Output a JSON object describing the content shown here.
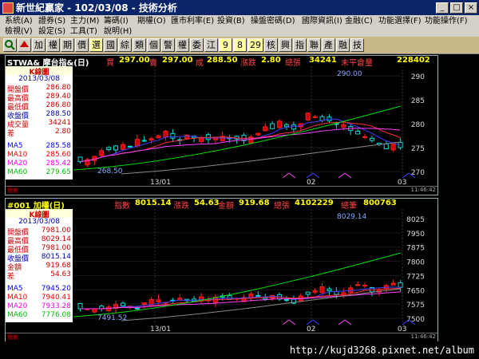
{
  "window": {
    "title": "新世紀贏家 - 102/03/08 - 技術分析"
  },
  "menu": [
    {
      "label": "系統(A)"
    },
    {
      "label": "證券(S)"
    },
    {
      "label": "主力(M)"
    },
    {
      "label": "籌碼(I)"
    },
    {
      "label": "期權(O)"
    },
    {
      "label": "匯市利率(E)"
    },
    {
      "label": "投資(B)"
    },
    {
      "label": "操盤密碼(D)"
    },
    {
      "label": "國際資訊(I)"
    },
    {
      "label": "金融(C)"
    },
    {
      "label": "功能選擇(F)"
    },
    {
      "label": "功能操作(F)"
    },
    {
      "label": "檢視(V)"
    },
    {
      "label": "設定(S)"
    },
    {
      "label": "工具(T)"
    },
    {
      "label": "說明(H)"
    }
  ],
  "toolbar": [
    "加",
    "權",
    "期",
    "價",
    "選",
    "國",
    "綜",
    "類",
    "個",
    "警",
    "權",
    "委",
    "江",
    "9",
    "8",
    "29",
    "核",
    "興",
    "指",
    "聯",
    "產",
    "融",
    "技"
  ],
  "panel1": {
    "symbol": "STWA& 摩台指&(日)",
    "buy_label": "買",
    "buy": "297.00",
    "sell_label": "賣",
    "sell": "297.00",
    "deal_label": "成",
    "deal": "288.50",
    "change_label": "漲跌",
    "change": "2.80",
    "vol_label": "總張",
    "vol": "34241",
    "oi_label": "未平倉量",
    "oi": "228402",
    "info_title": "K線圖",
    "info_date": "2013/03/08",
    "rows": [
      {
        "label": "開盤價",
        "value": "286.80",
        "color": "#c00"
      },
      {
        "label": "最高價",
        "value": "289.40",
        "color": "#c00"
      },
      {
        "label": "最低價",
        "value": "286.80",
        "color": "#c00"
      },
      {
        "label": "收盤價",
        "value": "288.50",
        "color": "#00a"
      },
      {
        "label": "成交量",
        "value": "34241",
        "color": "#c00"
      },
      {
        "label": "差",
        "value": "2.80",
        "color": "#c00"
      }
    ],
    "ma": [
      {
        "label": "MA5",
        "value": "285.58",
        "color": "#0000ff"
      },
      {
        "label": "MA10",
        "value": "285.60",
        "color": "#ff0000"
      },
      {
        "label": "MA20",
        "value": "285.42",
        "color": "#ff00ff"
      },
      {
        "label": "MA60",
        "value": "279.65",
        "color": "#00c000"
      }
    ],
    "high_label": "290.00",
    "low_label": "268.50",
    "y_ticks": [
      "290",
      "285",
      "280",
      "275",
      "270"
    ],
    "x_ticks": [
      "13/01",
      "02",
      "03"
    ],
    "footer_left": "指數",
    "footer_right": "11:46:42"
  },
  "panel2": {
    "symbol": "#001 加權(日)",
    "idx_label": "指數",
    "idx": "8015.14",
    "change_label": "漲跌",
    "change": "54.63",
    "amt_label": "金額",
    "amt": "919.68",
    "vol_label": "總張",
    "vol": "4102229",
    "cnt_label": "總筆",
    "cnt": "800763",
    "info_title": "K線圖",
    "info_date": "2013/03/08",
    "rows": [
      {
        "label": "開盤價",
        "value": "7981.00",
        "color": "#c00"
      },
      {
        "label": "最高價",
        "value": "8029.14",
        "color": "#c00"
      },
      {
        "label": "最低價",
        "value": "7981.00",
        "color": "#c00"
      },
      {
        "label": "收盤價",
        "value": "8015.14",
        "color": "#00a"
      },
      {
        "label": "金額",
        "value": "919.68",
        "color": "#c00"
      },
      {
        "label": "差",
        "value": "54.63",
        "color": "#c00"
      }
    ],
    "ma": [
      {
        "label": "MA5",
        "value": "7945.20",
        "color": "#0000ff"
      },
      {
        "label": "MA10",
        "value": "7940.41",
        "color": "#ff0000"
      },
      {
        "label": "MA20",
        "value": "7933.28",
        "color": "#ff00ff"
      },
      {
        "label": "MA60",
        "value": "7776.08",
        "color": "#00c000"
      }
    ],
    "high_label": "8029.14",
    "low_label": "7491.52",
    "y_ticks": [
      "8025",
      "7950",
      "7875",
      "7800",
      "7725",
      "7650",
      "7575",
      "7500"
    ],
    "x_ticks": [
      "13/01",
      "02",
      "03"
    ],
    "footer_left": "指數",
    "footer_right": "11:46:42"
  },
  "watermark": "http://kujd3268.pixnet.net/album"
}
